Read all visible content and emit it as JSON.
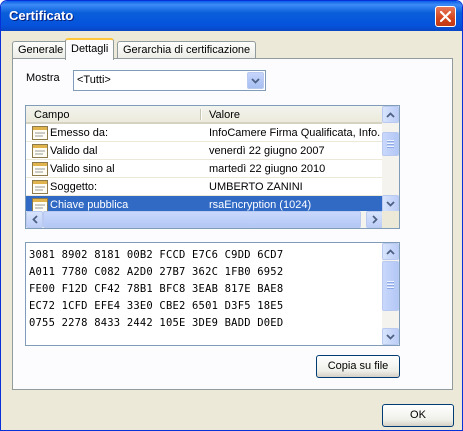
{
  "window": {
    "title": "Certificato"
  },
  "tabs": [
    {
      "label": "Generale",
      "active": false
    },
    {
      "label": "Dettagli",
      "active": true
    },
    {
      "label": "Gerarchia di certificazione",
      "active": false
    }
  ],
  "show": {
    "label": "Mostra",
    "selected": "<Tutti>"
  },
  "list": {
    "columns": [
      "Campo",
      "Valore"
    ],
    "rows": [
      {
        "field": "Emesso da:",
        "value": "InfoCamere Firma Qualificata, Info...",
        "selected": false
      },
      {
        "field": "Valido dal",
        "value": "venerdì 22 giugno 2007",
        "selected": false
      },
      {
        "field": "Valido sino al",
        "value": "martedì 22 giugno 2010",
        "selected": false
      },
      {
        "field": "Soggetto:",
        "value": "UMBERTO ZANINI",
        "selected": false
      },
      {
        "field": "Chiave pubblica",
        "value": "rsaEncryption (1024)",
        "selected": true
      }
    ]
  },
  "detail": {
    "lines": [
      "3081 8902 8181 00B2 FCCD E7C6 C9DD 6CD7",
      "A011 7780 C082 A2D0 27B7 362C 1FB0 6952",
      "FE00 F12D CF42 78B1 BFC8 3EAB 817E BAE8",
      "EC72 1CFD EFE4 33E0 CBE2 6501 D3F5 18E5",
      "0755 2278 8433 2442 105E 3DE9 BADD D0ED"
    ]
  },
  "buttons": {
    "copy_to_file": "Copia su file",
    "ok": "OK"
  },
  "colors": {
    "title_bar": "#0a5ce8",
    "selection": "#316ac5",
    "dialog_bg": "#ece9d8",
    "close_button": "#d4441b"
  }
}
